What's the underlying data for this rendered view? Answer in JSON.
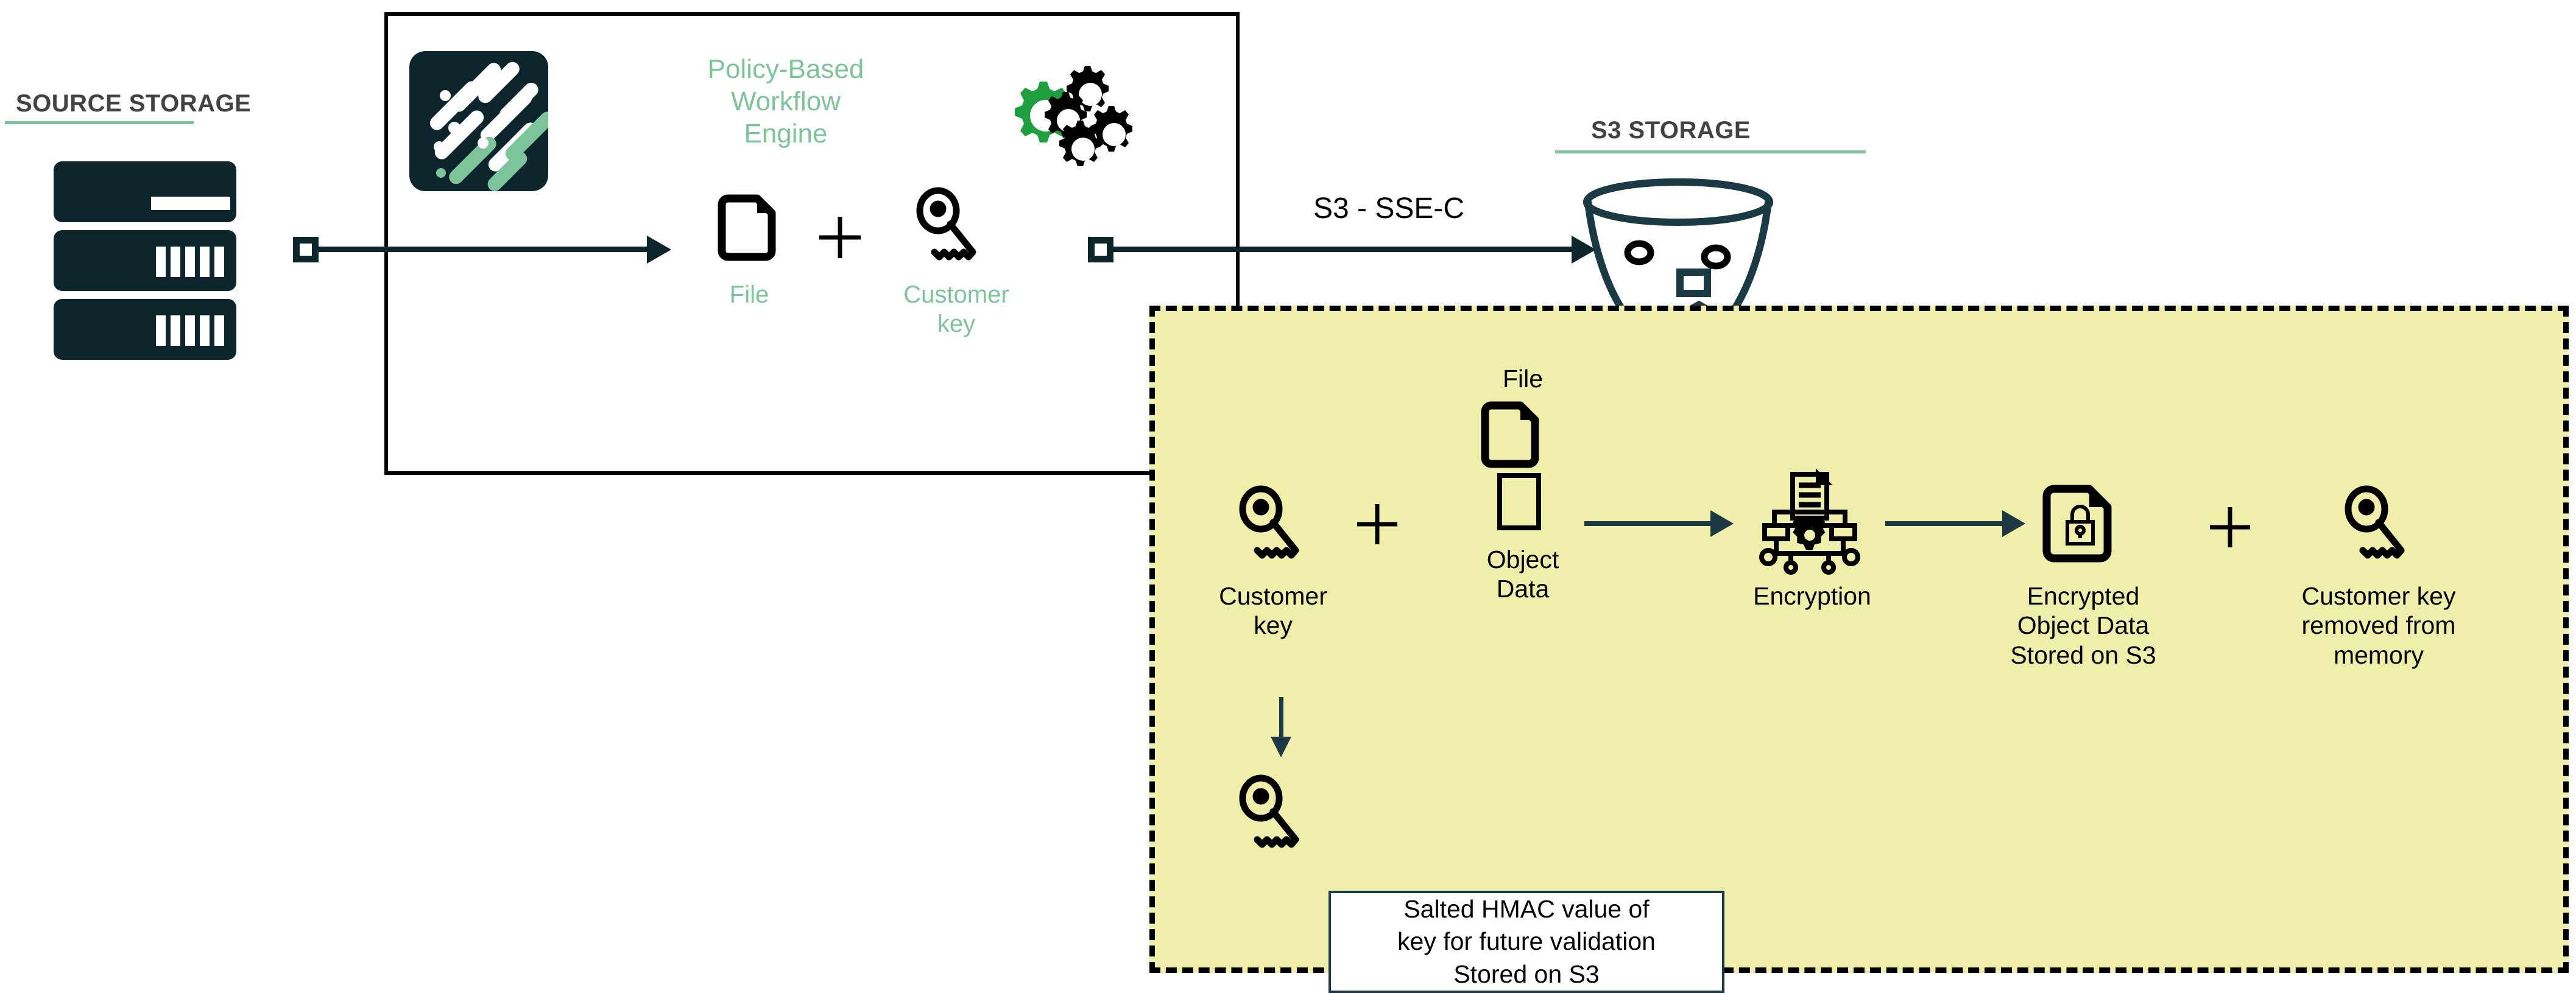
{
  "diagram": {
    "title_source": "SOURCE STORAGE",
    "title_s3": "S3 STORAGE",
    "transfer_label": "S3 - SSE-C"
  },
  "workflow_engine": {
    "engine_label": "Policy-Based\nWorkflow\nEngine",
    "engine_label_line1": "Policy-Based",
    "engine_label_line2": "Workflow",
    "engine_label_line3": "Engine",
    "file_label": "File",
    "plus_label": "+",
    "key_label_line1": "Customer",
    "key_label_line2": "key"
  },
  "sse_c_panel": {
    "file_caption": "File",
    "customer_key_line1": "Customer",
    "customer_key_line2": "key",
    "object_data_line1": "Object",
    "object_data_line2": "Data",
    "plus_1": "+",
    "plus_2": "+",
    "encryption_label": "Encryption",
    "encrypted_line1": "Encrypted",
    "encrypted_line2": "Object Data",
    "encrypted_line3": "Stored on S3",
    "removed_line1": "Customer key",
    "removed_line2": "removed from",
    "removed_line3": "memory",
    "hmac_line1": "Salted HMAC value of",
    "hmac_line2": "key for future validation",
    "hmac_line3": "Stored on S3"
  },
  "colors": {
    "dark": "#0d262e",
    "green_accent": "#7dc49b",
    "gear_green": "#1f9e3f",
    "panel_yellow": "#f0eeab",
    "heading_gray": "#434343",
    "black": "#000000"
  }
}
